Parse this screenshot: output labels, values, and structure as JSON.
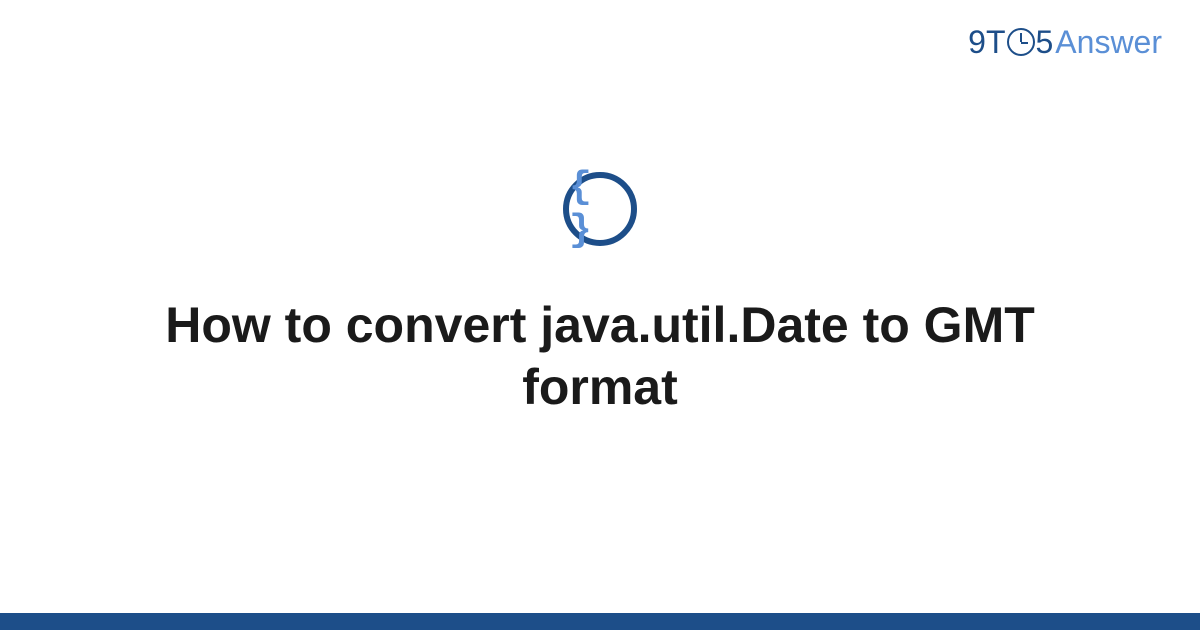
{
  "logo": {
    "part1": "9T",
    "part2": "5",
    "part3": "Answer"
  },
  "icon": {
    "glyph": "{ }",
    "name": "code-braces-icon"
  },
  "title": "How to convert java.util.Date to GMT format",
  "colors": {
    "darkBlue": "#1d4e89",
    "lightBlue": "#5a8fd6"
  }
}
